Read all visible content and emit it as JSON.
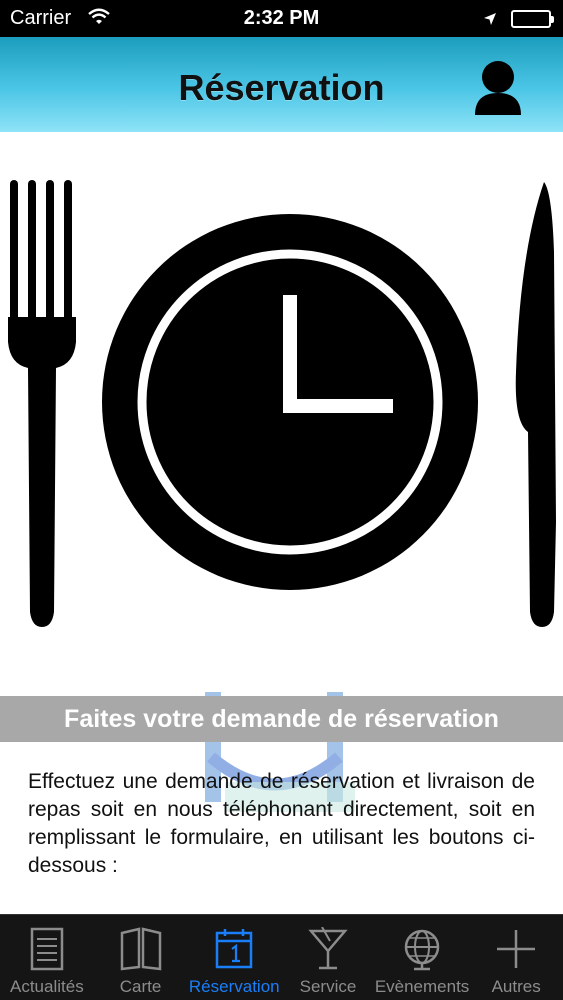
{
  "status_bar": {
    "carrier": "Carrier",
    "time": "2:32 PM"
  },
  "header": {
    "title": "Réservation",
    "profile_icon": "user-icon"
  },
  "hero": {
    "icon": "fork-plate-clock-knife-icon"
  },
  "banner": {
    "text": "Faites votre demande de réservation"
  },
  "intro": {
    "text": "Effectuez une demande de réservation et livraison de repas soit en nous téléphonant directement, soit en remplissant le formulaire, en utilisant les boutons ci-dessous :"
  },
  "tab_bar": {
    "active_color": "#1a7ef7",
    "tabs": [
      {
        "label": "Actualités",
        "icon": "news-icon"
      },
      {
        "label": "Carte",
        "icon": "book-icon"
      },
      {
        "label": "Réservation",
        "icon": "calendar-icon",
        "active": true
      },
      {
        "label": "Service",
        "icon": "cocktail-icon"
      },
      {
        "label": "Evènements",
        "icon": "globe-icon"
      },
      {
        "label": "Autres",
        "icon": "plus-icon"
      }
    ]
  },
  "colors": {
    "header_gradient_top": "#1c9dbd",
    "header_gradient_bottom": "#8ee3f7",
    "banner_bg": "#a8a8a8",
    "tabbar_bg": "#151515"
  }
}
